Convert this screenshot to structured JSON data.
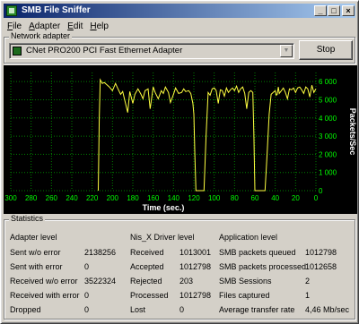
{
  "window": {
    "title": "SMB File Sniffer"
  },
  "menu": [
    {
      "accel": "F",
      "rest": "ile"
    },
    {
      "accel": "A",
      "rest": "dapter"
    },
    {
      "accel": "E",
      "rest": "dit"
    },
    {
      "accel": "H",
      "rest": "elp"
    }
  ],
  "adapter": {
    "group_label": "Network adapter",
    "selected": "CNet PRO200 PCI Fast Ethernet Adapter",
    "stop_label": "Stop"
  },
  "chart_data": {
    "type": "line",
    "xlabel": "Time (sec.)",
    "ylabel": "Packets/Sec",
    "xlim": [
      300,
      0
    ],
    "ylim": [
      0,
      6500
    ],
    "x_ticks": [
      "300",
      "280",
      "260",
      "240",
      "220",
      "200",
      "180",
      "160",
      "140",
      "120",
      "100",
      "80",
      "60",
      "40",
      "20",
      "0"
    ],
    "y_ticks": [
      "0",
      "1 000",
      "2 000",
      "3 000",
      "4 000",
      "5 000",
      "6 000"
    ],
    "grid": true,
    "colors": {
      "background": "#000000",
      "grid": "#008000",
      "axis_text": "#00ff00",
      "line": "#ffff40"
    },
    "series": [
      {
        "x": [
          214,
          213,
          212,
          210,
          208,
          205,
          203,
          200,
          197,
          195,
          192,
          190,
          188,
          185,
          183,
          180,
          178,
          175,
          172,
          170,
          168,
          165,
          163,
          160,
          158,
          155,
          152,
          150,
          148,
          145,
          143,
          140,
          138,
          135,
          132,
          130,
          128,
          125,
          123,
          121,
          120,
          119,
          118,
          116,
          114,
          112,
          110,
          108,
          106,
          104,
          102,
          100,
          98,
          96,
          94,
          92,
          90,
          88,
          86,
          84,
          82,
          80,
          78,
          76,
          74,
          72,
          70,
          68,
          66,
          64,
          62,
          61,
          60,
          59,
          58,
          56,
          54,
          52,
          50,
          48,
          46,
          44,
          42,
          40,
          39,
          38,
          37,
          36,
          34,
          32,
          30,
          28,
          26,
          24,
          22,
          20,
          18,
          16,
          14,
          12,
          10,
          8,
          6,
          4,
          2,
          0
        ],
        "y": [
          0,
          4000,
          6100,
          5900,
          5950,
          5800,
          5700,
          5500,
          5900,
          5650,
          5300,
          5450,
          5000,
          4300,
          5450,
          4800,
          5300,
          5600,
          5300,
          5050,
          5500,
          5600,
          4500,
          5700,
          5400,
          5050,
          5500,
          5350,
          5700,
          5400,
          4850,
          5300,
          5650,
          5350,
          5400,
          5600,
          5450,
          5500,
          5350,
          4800,
          4200,
          2000,
          0,
          0,
          0,
          0,
          0,
          3000,
          5400,
          5250,
          5600,
          5650,
          5500,
          4800,
          5550,
          5500,
          5200,
          5650,
          5400,
          5550,
          5650,
          5500,
          5750,
          5400,
          5600,
          5700,
          5350,
          4500,
          5400,
          5500,
          5400,
          3000,
          0,
          0,
          0,
          0,
          0,
          0,
          0,
          2000,
          4200,
          5300,
          5400,
          5500,
          5250,
          5300,
          5700,
          5350,
          5500,
          5650,
          5400,
          5050,
          5600,
          5550,
          5650,
          5400,
          5650,
          5700,
          5550,
          5350,
          5700,
          5600,
          5150,
          5800,
          5400,
          5600
        ]
      }
    ]
  },
  "stats": {
    "group_label": "Statistics",
    "adapter": {
      "header": "Adapter level",
      "rows": [
        {
          "label": "Sent w/o error",
          "value": "2138256"
        },
        {
          "label": "Sent with error",
          "value": "0"
        },
        {
          "label": "Received w/o error",
          "value": "3522324"
        },
        {
          "label": "Received with error",
          "value": "0"
        },
        {
          "label": "Dropped",
          "value": "0"
        }
      ]
    },
    "driver": {
      "header": "Nis_X Driver level",
      "rows": [
        {
          "label": "Received",
          "value": "1013001"
        },
        {
          "label": "Accepted",
          "value": "1012798"
        },
        {
          "label": "Rejected",
          "value": "203"
        },
        {
          "label": "Processed",
          "value": "1012798"
        },
        {
          "label": "Lost",
          "value": "0"
        }
      ]
    },
    "app": {
      "header": "Application level",
      "rows": [
        {
          "label": "SMB packets queued",
          "value": "1012798"
        },
        {
          "label": "SMB packets processed",
          "value": "1012658"
        },
        {
          "label": "SMB Sessions",
          "value": "2"
        },
        {
          "label": "Files captured",
          "value": "1"
        },
        {
          "label": "Average transfer rate",
          "value": "4,46 Mb/sec"
        }
      ]
    }
  }
}
